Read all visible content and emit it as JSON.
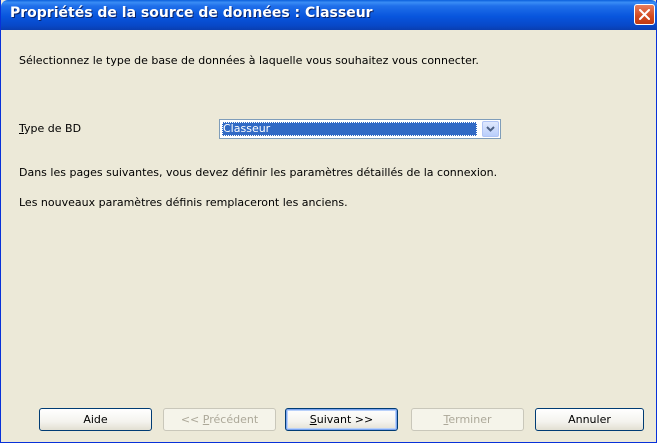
{
  "window": {
    "title": "Propriétés de la source de données : Classeur"
  },
  "main": {
    "intro": "Sélectionnez le type de base de données à laquelle vous souhaitez vous connecter.",
    "db_type_label_accel": "T",
    "db_type_label_rest": "ype de BD",
    "db_type_value": "Classeur",
    "info_line1": "Dans les pages suivantes, vous devez définir les paramètres détaillés de la connexion.",
    "info_line2": "Les nouveaux paramètres définis remplaceront les anciens."
  },
  "buttons": {
    "help": "Aide",
    "previous_pre": "<< ",
    "previous_accel": "P",
    "previous_rest": "récédent",
    "next_accel": "S",
    "next_rest": "uivant >>",
    "finish_accel": "T",
    "finish_rest": "erminer",
    "cancel": "Annuler"
  },
  "colors": {
    "title_bar": "#0855DD",
    "selection": "#316AC5",
    "dialog_bg": "#ECE9D8",
    "close_button": "#D24A1F"
  }
}
